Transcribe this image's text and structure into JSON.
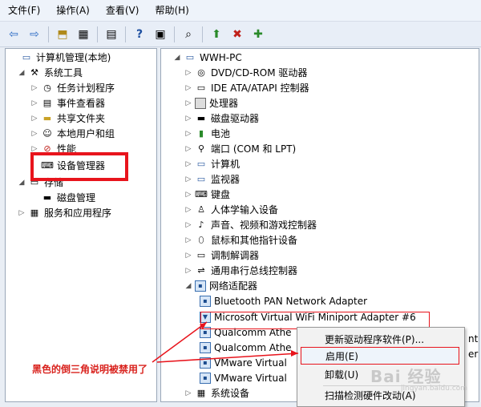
{
  "menu": [
    "文件(F)",
    "操作(A)",
    "查看(V)",
    "帮助(H)"
  ],
  "left_tree": [
    {
      "label": "计算机管理(本地)",
      "icon": "computer-icon",
      "expander": ""
    },
    {
      "label": "系统工具",
      "icon": "tools-icon",
      "expander": "◢"
    },
    {
      "label": "任务计划程序",
      "icon": "clock-icon",
      "expander": "▷"
    },
    {
      "label": "事件查看器",
      "icon": "log-icon",
      "expander": "▷"
    },
    {
      "label": "共享文件夹",
      "icon": "folder-icon",
      "expander": "▷"
    },
    {
      "label": "本地用户和组",
      "icon": "users-icon",
      "expander": "▷"
    },
    {
      "label": "性能",
      "icon": "performance-icon",
      "expander": "▷"
    },
    {
      "label": "设备管理器",
      "icon": "device-manager-icon",
      "expander": ""
    },
    {
      "label": "存储",
      "icon": "storage-icon",
      "expander": "◢"
    },
    {
      "label": "磁盘管理",
      "icon": "disk-icon",
      "expander": ""
    },
    {
      "label": "服务和应用程序",
      "icon": "services-icon",
      "expander": "▷"
    }
  ],
  "right_tree": [
    {
      "label": "WWH-PC",
      "icon": "computer-icon",
      "expander": "◢"
    },
    {
      "label": "DVD/CD-ROM 驱动器",
      "icon": "dvd-icon",
      "expander": "▷"
    },
    {
      "label": "IDE ATA/ATAPI 控制器",
      "icon": "ide-icon",
      "expander": "▷"
    },
    {
      "label": "处理器",
      "icon": "cpu-icon",
      "expander": "▷"
    },
    {
      "label": "磁盘驱动器",
      "icon": "disk-icon",
      "expander": "▷"
    },
    {
      "label": "电池",
      "icon": "battery-icon",
      "expander": "▷"
    },
    {
      "label": "端口 (COM 和 LPT)",
      "icon": "port-icon",
      "expander": "▷"
    },
    {
      "label": "计算机",
      "icon": "computer-icon",
      "expander": "▷"
    },
    {
      "label": "监视器",
      "icon": "monitor-icon",
      "expander": "▷"
    },
    {
      "label": "键盘",
      "icon": "keyboard-icon",
      "expander": "▷"
    },
    {
      "label": "人体学输入设备",
      "icon": "hid-icon",
      "expander": "▷"
    },
    {
      "label": "声音、视频和游戏控制器",
      "icon": "sound-icon",
      "expander": "▷"
    },
    {
      "label": "鼠标和其他指针设备",
      "icon": "mouse-icon",
      "expander": "▷"
    },
    {
      "label": "调制解调器",
      "icon": "modem-icon",
      "expander": "▷"
    },
    {
      "label": "通用串行总线控制器",
      "icon": "usb-icon",
      "expander": "▷"
    },
    {
      "label": "网络适配器",
      "icon": "network-icon",
      "expander": "◢"
    },
    {
      "label": "Bluetooth PAN Network Adapter",
      "icon": "network-adapter-icon",
      "expander": ""
    },
    {
      "label": "Microsoft Virtual WiFi Miniport Adapter #6",
      "icon": "network-adapter-disabled-icon",
      "expander": ""
    },
    {
      "label": "Qualcomm Athe",
      "icon": "network-adapter-icon",
      "expander": ""
    },
    {
      "label": "Qualcomm Athe",
      "icon": "network-adapter-icon",
      "expander": ""
    },
    {
      "label": "VMware Virtual",
      "icon": "network-adapter-icon",
      "expander": ""
    },
    {
      "label": "VMware Virtual",
      "icon": "network-adapter-icon",
      "expander": ""
    },
    {
      "label": "系统设备",
      "icon": "system-icon",
      "expander": "▷"
    }
  ],
  "right_overflow": [
    "ntr",
    "er"
  ],
  "context_menu": [
    "更新驱动程序软件(P)...",
    "启用(E)",
    "卸载(U)",
    "扫描检测硬件改动(A)"
  ],
  "annotation": "黑色的倒三角说明被禁用了",
  "watermark": "Bai 经验",
  "watermark_sub": "jingyan.baidu.com",
  "colors": {
    "highlight": "#e8141c",
    "annotation": "#d9231e"
  }
}
